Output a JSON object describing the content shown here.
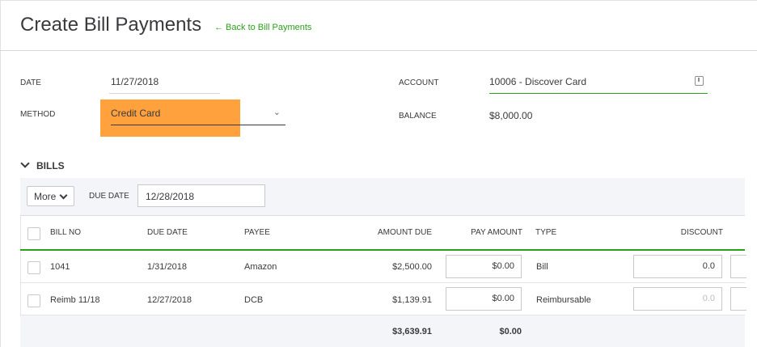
{
  "header": {
    "title": "Create Bill Payments",
    "back_link": "← Back to Bill Payments"
  },
  "form": {
    "date_label": "DATE",
    "date_value": "11/27/2018",
    "method_label": "METHOD",
    "method_value": "Credit Card",
    "account_label": "ACCOUNT",
    "account_value": "10006 - Discover Card",
    "balance_label": "BALANCE",
    "balance_value": "$8,000.00",
    "highlight_color": "#ffa13d"
  },
  "bills": {
    "section_title": "BILLS",
    "more_label": "More",
    "due_date_filter_label": "DUE DATE",
    "due_date_filter_value": "12/28/2018",
    "columns": [
      "BILL NO",
      "DUE DATE",
      "PAYEE",
      "AMOUNT DUE",
      "PAY AMOUNT",
      "TYPE",
      "DISCOUNT"
    ],
    "rows": [
      {
        "bill_no": "1041",
        "due_date": "1/31/2018",
        "payee": "Amazon",
        "amount_due": "$2,500.00",
        "pay_amount": "$0.00",
        "type": "Bill",
        "discount": "0.0"
      },
      {
        "bill_no": "Reimb 11/18",
        "due_date": "12/27/2018",
        "payee": "DCB",
        "amount_due": "$1,139.91",
        "pay_amount": "$0.00",
        "type": "Reimbursable",
        "discount": "0.0"
      }
    ],
    "totals": {
      "amount_due": "$3,639.91",
      "pay_amount": "$0.00"
    }
  }
}
